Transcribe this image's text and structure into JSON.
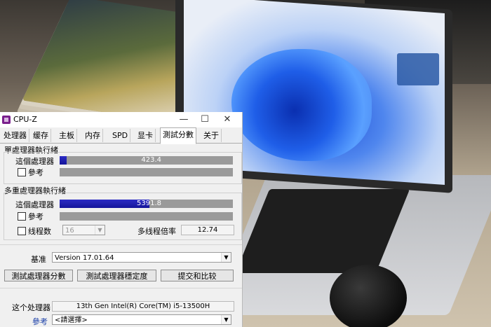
{
  "window": {
    "title": "CPU-Z"
  },
  "tabs": [
    "处理器",
    "缓存",
    "主板",
    "内存",
    "SPD",
    "显卡",
    "測試分數",
    "关于"
  ],
  "active_tab": "測試分數",
  "single_thread": {
    "heading": "單處理器執行緒",
    "this_label": "這個處理器",
    "this_value": "423.4",
    "this_fill": 0.04,
    "ref_label": "參考",
    "ref_fill": 0
  },
  "multi_thread": {
    "heading": "多重處理器執行緒",
    "this_label": "這個處理器",
    "this_value": "5391.8",
    "this_fill": 0.52,
    "ref_label": "參考",
    "ref_fill": 0,
    "threads_label": "线程数",
    "threads_value": "16",
    "ratio_label": "多线程倍率",
    "ratio_value": "12.74"
  },
  "benchmark": {
    "label": "基准",
    "version": "Version 17.01.64",
    "btn_bench": "測試處理器分數",
    "btn_stability": "測試處理器穩定度",
    "btn_submit": "提交和比较"
  },
  "cpu": {
    "label": "这个处理器",
    "name": "13th Gen Intel(R) Core(TM) i5-13500H",
    "ref_label": "參考",
    "ref_value": "<請選擇>"
  },
  "colors": {
    "bar_fill": "#1b1ba8",
    "bar_track": "#9a9a9a",
    "window_bg": "#f0f0f0"
  },
  "icons": [
    "cpuz-app-icon",
    "minimize-icon",
    "maximize-icon",
    "close-icon",
    "chevron-down-icon"
  ]
}
